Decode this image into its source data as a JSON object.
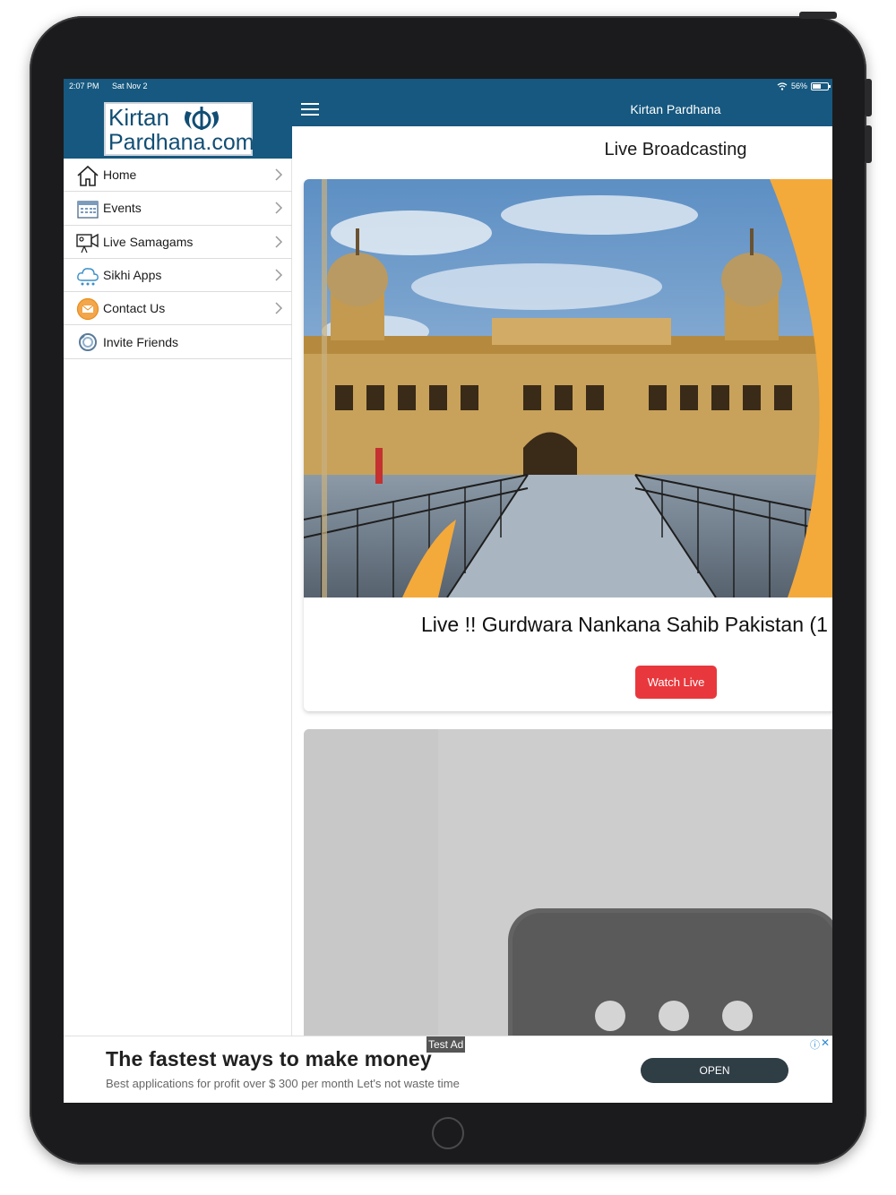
{
  "status_bar": {
    "time": "2:07 PM",
    "date": "Sat Nov 2",
    "battery": "56%"
  },
  "logo": {
    "line1": "Kirtan",
    "line2": "Pardhana.com"
  },
  "sidebar": {
    "items": [
      {
        "label": "Home",
        "icon": "home-icon",
        "chevron": true
      },
      {
        "label": "Events",
        "icon": "calendar-icon",
        "chevron": true
      },
      {
        "label": "Live Samagams",
        "icon": "video-camera-icon",
        "chevron": true
      },
      {
        "label": "Sikhi Apps",
        "icon": "cloud-apps-icon",
        "chevron": true
      },
      {
        "label": "Contact Us",
        "icon": "mail-icon",
        "chevron": true
      },
      {
        "label": "Invite Friends",
        "icon": "share-icon",
        "chevron": false
      }
    ]
  },
  "topbar": {
    "title": "Kirtan Pardhana"
  },
  "main": {
    "page_title": "Live Broadcasting",
    "cards": [
      {
        "title": "Live !! Gurdwara Nankana Sahib Pakistan (1",
        "button_label": "Watch Live"
      }
    ]
  },
  "ad": {
    "badge": "Test Ad",
    "headline": "The fastest ways to make money",
    "body": "Best applications for profit over $ 300 per month Let's not waste time",
    "cta": "OPEN",
    "info_icon": "info-icon",
    "close_icon": "close-icon"
  },
  "colors": {
    "header_blue": "#16587f",
    "watch_button_red": "#e8383d",
    "ad_button": "#2f3d45"
  }
}
